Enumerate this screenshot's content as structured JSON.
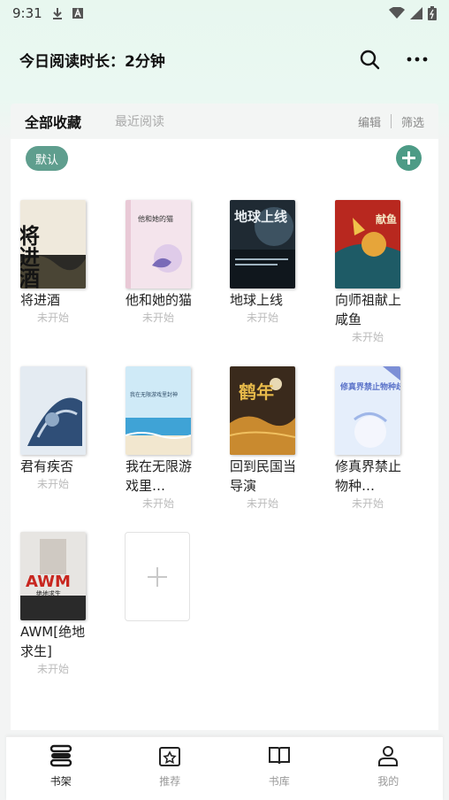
{
  "status_bar": {
    "time": "9:31",
    "icons": [
      "download-icon",
      "text-a-icon",
      "wifi-icon",
      "signal-icon",
      "battery-icon"
    ]
  },
  "header": {
    "title": "今日阅读时长：2分钟",
    "icons": [
      "search-icon",
      "more-icon"
    ]
  },
  "tabs": {
    "active": "全部收藏",
    "inactive": "最近阅读",
    "edit": "编辑",
    "filter": "筛选"
  },
  "group_chip": "默认",
  "books": [
    {
      "title": "将进酒",
      "status": "未开始"
    },
    {
      "title": "他和她的猫",
      "status": "未开始"
    },
    {
      "title": "地球上线",
      "status": "未开始"
    },
    {
      "title": "向师祖献上咸鱼",
      "status": "未开始"
    },
    {
      "title": "君有疾否",
      "status": "未开始"
    },
    {
      "title": "我在无限游戏里…",
      "status": "未开始"
    },
    {
      "title": "回到民国当导演",
      "status": "未开始"
    },
    {
      "title": "修真界禁止物种…",
      "status": "未开始"
    },
    {
      "title": "AWM[绝地求生]",
      "status": "未开始"
    }
  ],
  "covers": {
    "c1": {
      "text": "将进酒"
    },
    "c2": {
      "text": "他和她的猫"
    },
    "c3": {
      "text": "地球上线"
    },
    "c4": {
      "text": "献鱼"
    },
    "c6": {
      "text": "我在无限游戏里封神"
    },
    "c7": {
      "text": "鹤年"
    },
    "c8": {
      "text": "修真界禁止物种歧视"
    },
    "c9": {
      "text": "AWM",
      "sub": "绝地求生"
    }
  },
  "bottom_nav": [
    {
      "label": "书架",
      "icon": "bookshelf-icon",
      "active": true
    },
    {
      "label": "推荐",
      "icon": "star-box-icon",
      "active": false
    },
    {
      "label": "书库",
      "icon": "open-book-icon",
      "active": false
    },
    {
      "label": "我的",
      "icon": "person-icon",
      "active": false
    }
  ],
  "colors": {
    "accent": "#5f9e8e",
    "add_button": "#4d9b86",
    "header_bg": "#e8f7ef"
  }
}
